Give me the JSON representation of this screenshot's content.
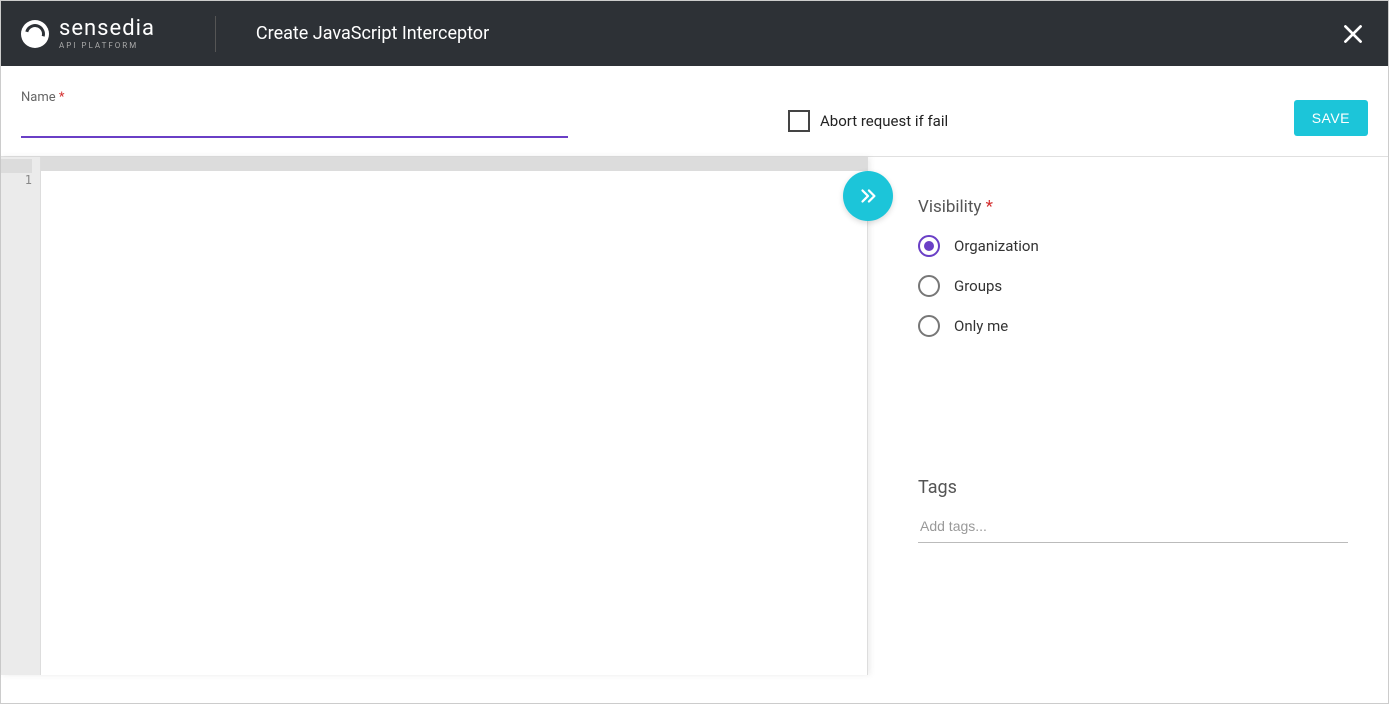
{
  "header": {
    "brand_name": "sensedia",
    "brand_subtitle": "API PLATFORM",
    "page_title": "Create JavaScript Interceptor"
  },
  "form": {
    "name_label": "Name",
    "name_value": "",
    "abort_label": "Abort request if fail",
    "abort_checked": false,
    "save_label": "SAVE"
  },
  "editor": {
    "line_numbers": [
      "1"
    ]
  },
  "visibility": {
    "label": "Visibility",
    "options": [
      {
        "label": "Organization",
        "selected": true
      },
      {
        "label": "Groups",
        "selected": false
      },
      {
        "label": "Only me",
        "selected": false
      }
    ]
  },
  "tags": {
    "title": "Tags",
    "placeholder": "Add tags..."
  }
}
